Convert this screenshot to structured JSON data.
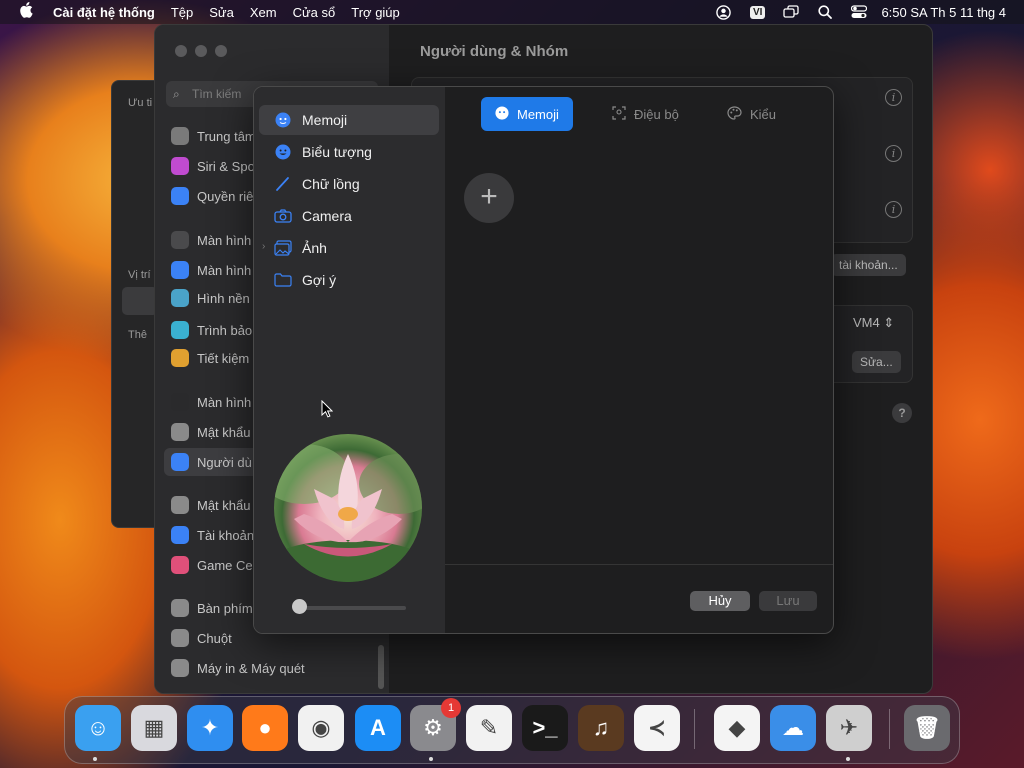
{
  "menubar": {
    "app_name": "Cài đặt hệ thống",
    "menus": [
      "Tệp",
      "Sửa",
      "Xem",
      "Cửa sổ",
      "Trợ giúp"
    ],
    "input_source": "VI",
    "clock": "6:50 SA Th 5 11 thg 4"
  },
  "back_window": {
    "label_1": "Ưu ti",
    "label_2": "Vị trí",
    "label_3": "Thê"
  },
  "settings": {
    "title": "Người dùng & Nhóm",
    "search_placeholder": "Tìm kiếm",
    "sidebar_items": [
      {
        "label": "Trung tâm",
        "color": "#7a7a7a"
      },
      {
        "label": "Siri & Spo",
        "color": "#c04bd0"
      },
      {
        "label": "Quyền riê",
        "color": "#3b82f6"
      },
      {
        "label": "Màn hình",
        "color": "#4a4a4c"
      },
      {
        "label": "Màn hình",
        "color": "#3b82f6"
      },
      {
        "label": "Hình nền",
        "color": "#4aa3c9"
      },
      {
        "label": "Trình bảo",
        "color": "#3ab0d0"
      },
      {
        "label": "Tiết kiệm",
        "color": "#e0a030"
      },
      {
        "label": "Màn hình",
        "color": "#2a2a2c"
      },
      {
        "label": "Mật khẩu",
        "color": "#8a8a8a"
      },
      {
        "label": "Người dù",
        "color": "#3b82f6"
      },
      {
        "label": "Mật khẩu",
        "color": "#8a8a8a"
      },
      {
        "label": "Tài khoản",
        "color": "#3b82f6"
      },
      {
        "label": "Game Ce",
        "color": "#e0507a"
      },
      {
        "label": "Bàn phím",
        "color": "#8a8a8a"
      },
      {
        "label": "Chuột",
        "color": "#8a8a8a"
      },
      {
        "label": "Máy in & Máy quét",
        "color": "#8a8a8a"
      }
    ],
    "account_button": "tài khoản...",
    "vm_value": "VM4 ⇕",
    "edit_button": "Sửa...",
    "help_label": "?"
  },
  "dialog": {
    "sidebar_items": [
      {
        "label": "Memoji",
        "icon": "memoji-icon"
      },
      {
        "label": "Biểu tượng",
        "icon": "emoji-icon"
      },
      {
        "label": "Chữ lồng",
        "icon": "monogram-icon"
      },
      {
        "label": "Camera",
        "icon": "camera-icon"
      },
      {
        "label": "Ảnh",
        "icon": "photos-icon"
      },
      {
        "label": "Gợi ý",
        "icon": "suggestions-icon"
      }
    ],
    "tabs": [
      "Memoji",
      "Điệu bộ",
      "Kiểu"
    ],
    "add_label": "+",
    "cancel_button": "Hủy",
    "save_button": "Lưu",
    "accent_color": "#1f7ae8"
  },
  "dock": {
    "apps": [
      {
        "name": "finder",
        "glyph": "☺",
        "color": "#3aa0f0"
      },
      {
        "name": "launchpad",
        "glyph": "▦",
        "color": "#d9d9de"
      },
      {
        "name": "safari",
        "glyph": "✦",
        "color": "#2f8ef0"
      },
      {
        "name": "firefox",
        "glyph": "●",
        "color": "#ff7a1a"
      },
      {
        "name": "chrome",
        "glyph": "◉",
        "color": "#f1f1f1"
      },
      {
        "name": "app-store",
        "glyph": "A",
        "color": "#1c8df5"
      },
      {
        "name": "system-settings",
        "glyph": "⚙",
        "color": "#8a8a8e"
      },
      {
        "name": "textedit",
        "glyph": "✎",
        "color": "#f2f2f2"
      },
      {
        "name": "terminal",
        "glyph": ">_",
        "color": "#1a1a1a"
      },
      {
        "name": "garageband",
        "glyph": "♫",
        "color": "#5a3a20"
      },
      {
        "name": "vscode",
        "glyph": "≺",
        "color": "#f4f4f4"
      },
      {
        "name": "visual-studio",
        "glyph": "◆",
        "color": "#f4f4f4"
      },
      {
        "name": "weather",
        "glyph": "☁",
        "color": "#3a8ee8"
      },
      {
        "name": "automator",
        "glyph": "✈",
        "color": "#cfcfcf"
      },
      {
        "name": "trash",
        "glyph": "🗑",
        "color": "#6a6a6e"
      }
    ],
    "settings_badge": "1"
  }
}
